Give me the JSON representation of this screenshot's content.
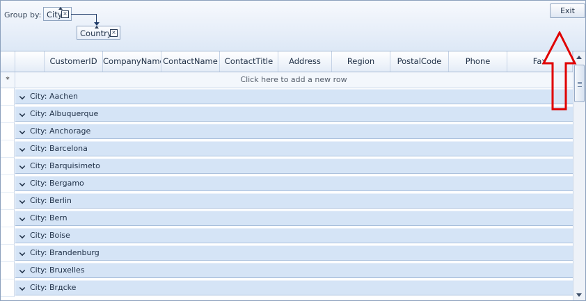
{
  "group_panel": {
    "label": "Group by:",
    "chips": [
      "City",
      "Country"
    ],
    "remove_glyph": "☒"
  },
  "toolbar": {
    "exit_label": "Exit"
  },
  "grid": {
    "columns": [
      "CustomerID",
      "CompanyName",
      "ContactName",
      "ContactTitle",
      "Address",
      "Region",
      "PostalCode",
      "Phone",
      "Fax"
    ],
    "new_row_marker": "*",
    "new_row_text": "Click here to add a new row",
    "groups": [
      "City: Aachen",
      "City: Albuquerque",
      "City: Anchorage",
      "City: Barcelona",
      "City: Barquisimeto",
      "City: Bergamo",
      "City: Berlin",
      "City: Bern",
      "City: Boise",
      "City: Brandenburg",
      "City: Bruxelles",
      "City: Brдcke"
    ]
  },
  "annotation": {
    "color": "#e00000",
    "icon": "up-arrow-icon"
  }
}
